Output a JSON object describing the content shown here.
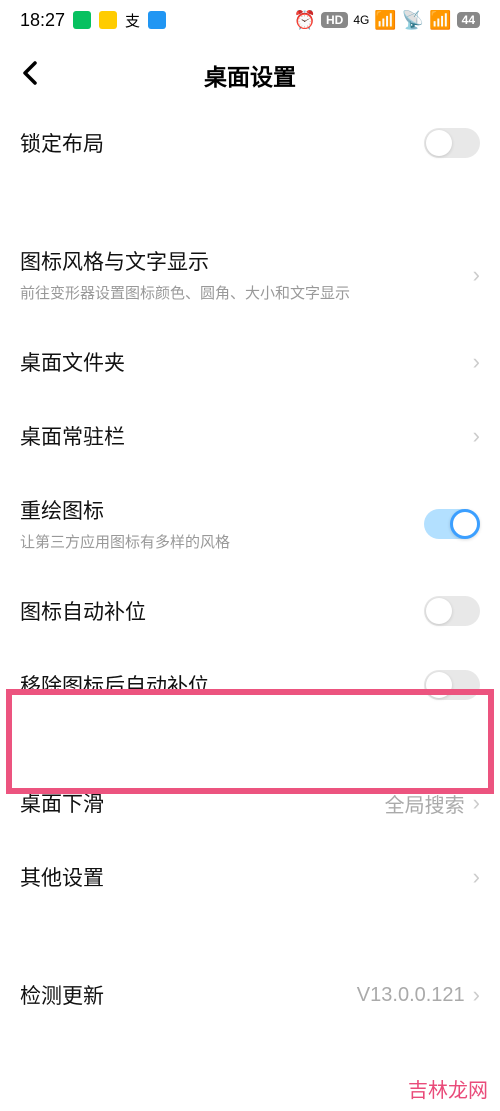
{
  "status": {
    "time": "18:27",
    "signal": "4G",
    "hd": "HD",
    "battery": "44"
  },
  "nav": {
    "title": "桌面设置"
  },
  "rows": {
    "lock_layout": {
      "title": "锁定布局"
    },
    "icon_style": {
      "title": "图标风格与文字显示",
      "subtitle": "前往变形器设置图标颜色、圆角、大小和文字显示"
    },
    "folder": {
      "title": "桌面文件夹"
    },
    "dock": {
      "title": "桌面常驻栏"
    },
    "redraw": {
      "title": "重绘图标",
      "subtitle": "让第三方应用图标有多样的风格"
    },
    "autofill": {
      "title": "图标自动补位"
    },
    "remove_autofill": {
      "title": "移除图标后自动补位"
    },
    "swipe_down": {
      "title": "桌面下滑",
      "value": "全局搜索"
    },
    "other": {
      "title": "其他设置"
    },
    "update": {
      "title": "检测更新",
      "value": "V13.0.0.121"
    }
  },
  "watermark": "吉林龙网"
}
